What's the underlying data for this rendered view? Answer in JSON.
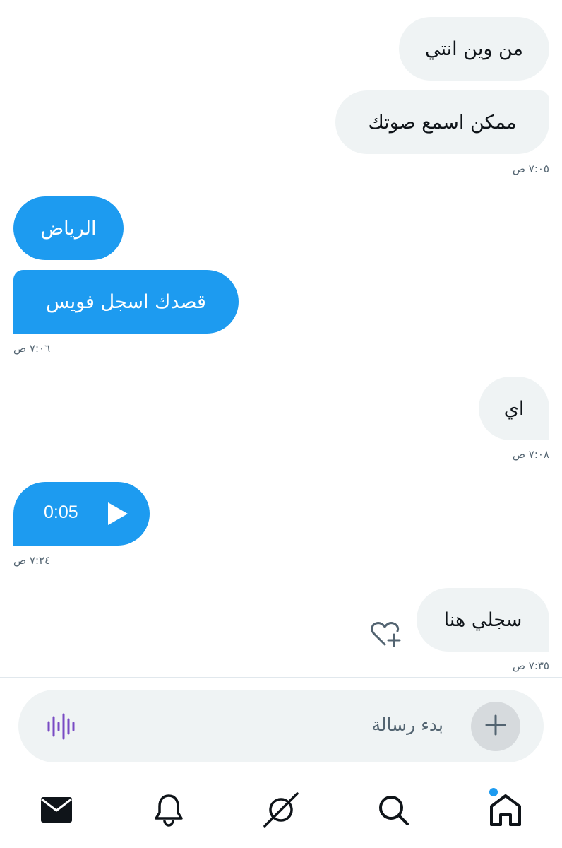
{
  "messages": [
    {
      "text": "من وين انتي"
    },
    {
      "text": "ممكن اسمع صوتك",
      "time": "٧:٠٥ ص"
    },
    {
      "text": "الرياض"
    },
    {
      "text": "قصدك اسجل فويس",
      "time": "٧:٠٦ ص"
    },
    {
      "text": "اي",
      "time": "٧:٠٨ ص"
    },
    {
      "text": "0:05",
      "time": "٧:٢٤ ص"
    },
    {
      "text": "سجلي هنا",
      "time": "٧:٣٥ ص"
    }
  ],
  "composer": {
    "placeholder": "بدء رسالة"
  },
  "icons": {
    "play": "play-icon",
    "react": "heart-plus-icon",
    "add": "plus-icon",
    "voice": "voice-wave-icon",
    "nav": [
      "mail-icon",
      "bell-icon",
      "spaces-icon",
      "search-icon",
      "home-icon"
    ]
  },
  "colors": {
    "accent": "#1d9bf0",
    "incoming": "#eff3f4",
    "voice": "#794bc4"
  }
}
